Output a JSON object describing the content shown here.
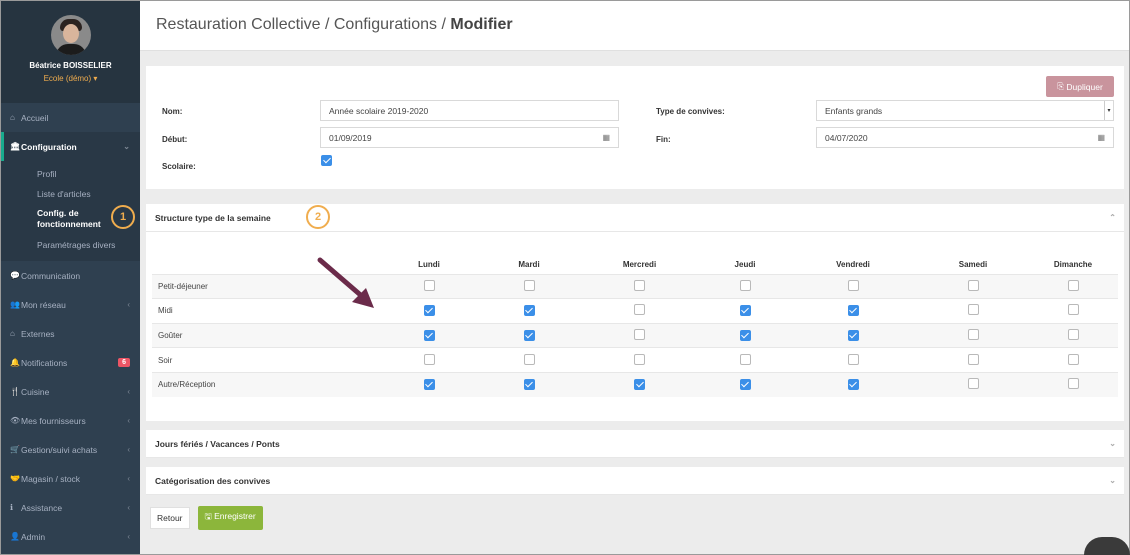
{
  "sidebar": {
    "user_name": "Béatrice BOISSELIER",
    "school": "Ecole (démo) ▾",
    "items": [
      {
        "icon": "home-icon",
        "glyph": "⌂",
        "label": "Accueil"
      },
      {
        "icon": "bank-icon",
        "glyph": "🏛",
        "label": "Configuration",
        "arrow": "⌄"
      },
      {
        "icon": "chat-icon",
        "glyph": "💬",
        "label": "Communication"
      },
      {
        "icon": "people-icon",
        "glyph": "👥",
        "label": "Mon réseau",
        "arrow": "‹"
      },
      {
        "icon": "home-icon",
        "glyph": "⌂",
        "label": "Externes"
      },
      {
        "icon": "bell-icon",
        "glyph": "🔔",
        "label": "Notifications",
        "badge": "6"
      },
      {
        "icon": "cutlery-icon",
        "glyph": "🍴",
        "label": "Cuisine",
        "arrow": "‹"
      },
      {
        "icon": "eye-icon",
        "glyph": "👁",
        "label": "Mes fournisseurs",
        "arrow": "‹"
      },
      {
        "icon": "cart-icon",
        "glyph": "🛒",
        "label": "Gestion/suivi achats",
        "arrow": "‹"
      },
      {
        "icon": "handshake-icon",
        "glyph": "🤝",
        "label": "Magasin / stock",
        "arrow": "‹"
      },
      {
        "icon": "info-icon",
        "glyph": "ℹ",
        "label": "Assistance",
        "arrow": "‹"
      },
      {
        "icon": "user-plus-icon",
        "glyph": "👤",
        "label": "Admin",
        "arrow": "‹"
      }
    ],
    "sub_items": [
      "Profil",
      "Liste d'articles",
      "Config. de fonctionnement",
      "Paramétrages divers"
    ]
  },
  "header": {
    "breadcrumb": "Restauration Collective / Configurations / ",
    "current": "Modifier"
  },
  "form": {
    "duplicate_label": "Dupliquer",
    "nom_label": "Nom:",
    "nom_value": "Année scolaire 2019-2020",
    "debut_label": "Début:",
    "debut_value": "01/09/2019",
    "scolaire_label": "Scolaire:",
    "scolaire_checked": true,
    "type_label": "Type de convives:",
    "type_value": "Enfants grands",
    "fin_label": "Fin:",
    "fin_value": "04/07/2020"
  },
  "structure": {
    "title": "Structure type de la semaine",
    "days": [
      "Lundi",
      "Mardi",
      "Mercredi",
      "Jeudi",
      "Vendredi",
      "Samedi",
      "Dimanche"
    ],
    "rows": [
      {
        "label": "Petit-déjeuner",
        "checks": [
          false,
          false,
          false,
          false,
          false,
          false,
          false
        ]
      },
      {
        "label": "Midi",
        "checks": [
          true,
          true,
          false,
          true,
          true,
          false,
          false
        ]
      },
      {
        "label": "Goûter",
        "checks": [
          true,
          true,
          false,
          true,
          true,
          false,
          false
        ]
      },
      {
        "label": "Soir",
        "checks": [
          false,
          false,
          false,
          false,
          false,
          false,
          false
        ]
      },
      {
        "label": "Autre/Réception",
        "checks": [
          true,
          true,
          true,
          true,
          true,
          false,
          false
        ]
      }
    ]
  },
  "panels": {
    "holidays": "Jours fériés / Vacances / Ponts",
    "categories": "Catégorisation des convives"
  },
  "actions": {
    "back": "Retour",
    "save": "Enregistrer"
  },
  "callouts": [
    "1",
    "2"
  ],
  "colors": {
    "sidebar": "#2f4050",
    "accent_checkbox": "#3b8fe8",
    "save_button": "#8cb63b",
    "duplicate_button": "#c9949d",
    "callout": "#f0ad4e",
    "arrow": "#6b2b4a"
  }
}
